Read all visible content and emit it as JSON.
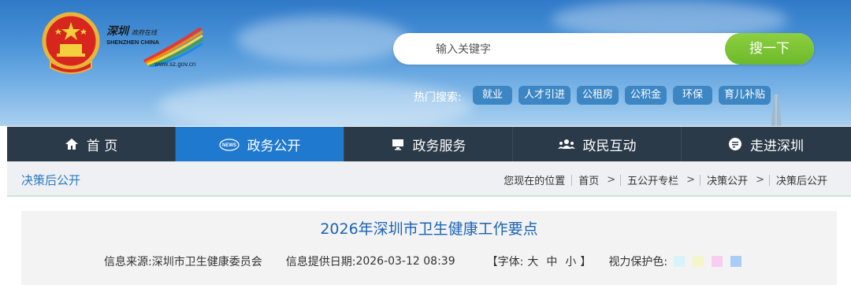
{
  "logo": {
    "cn_text": "深圳政府在线",
    "en_text": "SHENZHEN CHINA",
    "url": "www.sz.gov.cn"
  },
  "search": {
    "placeholder": "输入关键字",
    "button_label": "搜一下"
  },
  "hot_search": {
    "label": "热门搜索:",
    "tags": [
      "就业",
      "人才引进",
      "公租房",
      "公积金",
      "环保",
      "育儿补贴"
    ]
  },
  "nav": {
    "items": [
      {
        "label": "首 页",
        "icon": "home-icon",
        "active": false
      },
      {
        "label": "政务公开",
        "icon": "news-icon",
        "active": true
      },
      {
        "label": "政务服务",
        "icon": "monitor-icon",
        "active": false
      },
      {
        "label": "政民互动",
        "icon": "people-icon",
        "active": false
      },
      {
        "label": "走进深圳",
        "icon": "info-icon",
        "active": false
      }
    ]
  },
  "section_title": "决策后公开",
  "breadcrumb": {
    "prefix": "您现在的位置",
    "items": [
      "首页",
      "五公开专栏",
      "决策公开",
      "决策后公开"
    ]
  },
  "article": {
    "title": "2026年深圳市卫生健康工作要点",
    "source_label": "信息来源:",
    "source": "深圳市卫生健康委员会",
    "date_label": "信息提供日期:",
    "date": "2026-03-12 08:39",
    "font_label": "【字体:",
    "font_sizes": [
      "大",
      "中",
      "小"
    ],
    "font_close": "】",
    "eye_label": "视力保护色:",
    "eye_colors": [
      "#d8f3fa",
      "#f6f4c9",
      "#f8cdf0",
      "#a9cdf7"
    ]
  },
  "colors": {
    "accent_blue": "#1f79cf",
    "nav_bg": "#2b3a48",
    "search_green": "#7cc436"
  }
}
